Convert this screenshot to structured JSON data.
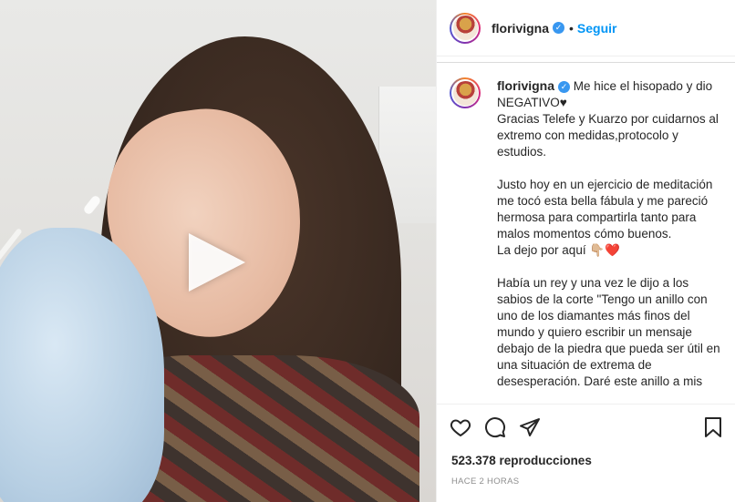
{
  "post": {
    "username": "florivigna",
    "follow_label": "Seguir",
    "separator": "•",
    "caption": "Me hice el hisopado y dio NEGATIVO♥\nGracias Telefe y Kuarzo por cuidarnos al extremo con medidas,protocolo y estudios.\n\nJusto hoy en un ejercicio de meditación me tocó esta bella fábula y me pareció hermosa para compartirla tanto para malos momentos cómo buenos.\nLa dejo por aquí 👇🏼❤️\n\nHabía un rey y una vez le dijo a los sabios de la corte \"Tengo un anillo con uno de los diamantes más finos del mundo y quiero escribir un mensaje debajo de la piedra que pueda ser útil en una situación de extrema de desesperación. Daré este anillo a mis",
    "views": "523.378 reproducciones",
    "time_ago": "HACE 2 HORAS"
  },
  "icons": {
    "verified": "verified-badge-icon",
    "like": "heart-icon",
    "comment": "comment-icon",
    "share": "share-icon",
    "save": "bookmark-icon",
    "play": "play-icon"
  },
  "colors": {
    "accent": "#0095f6",
    "verified": "#3897f0",
    "text": "#262626",
    "muted": "#8e8e8e"
  }
}
